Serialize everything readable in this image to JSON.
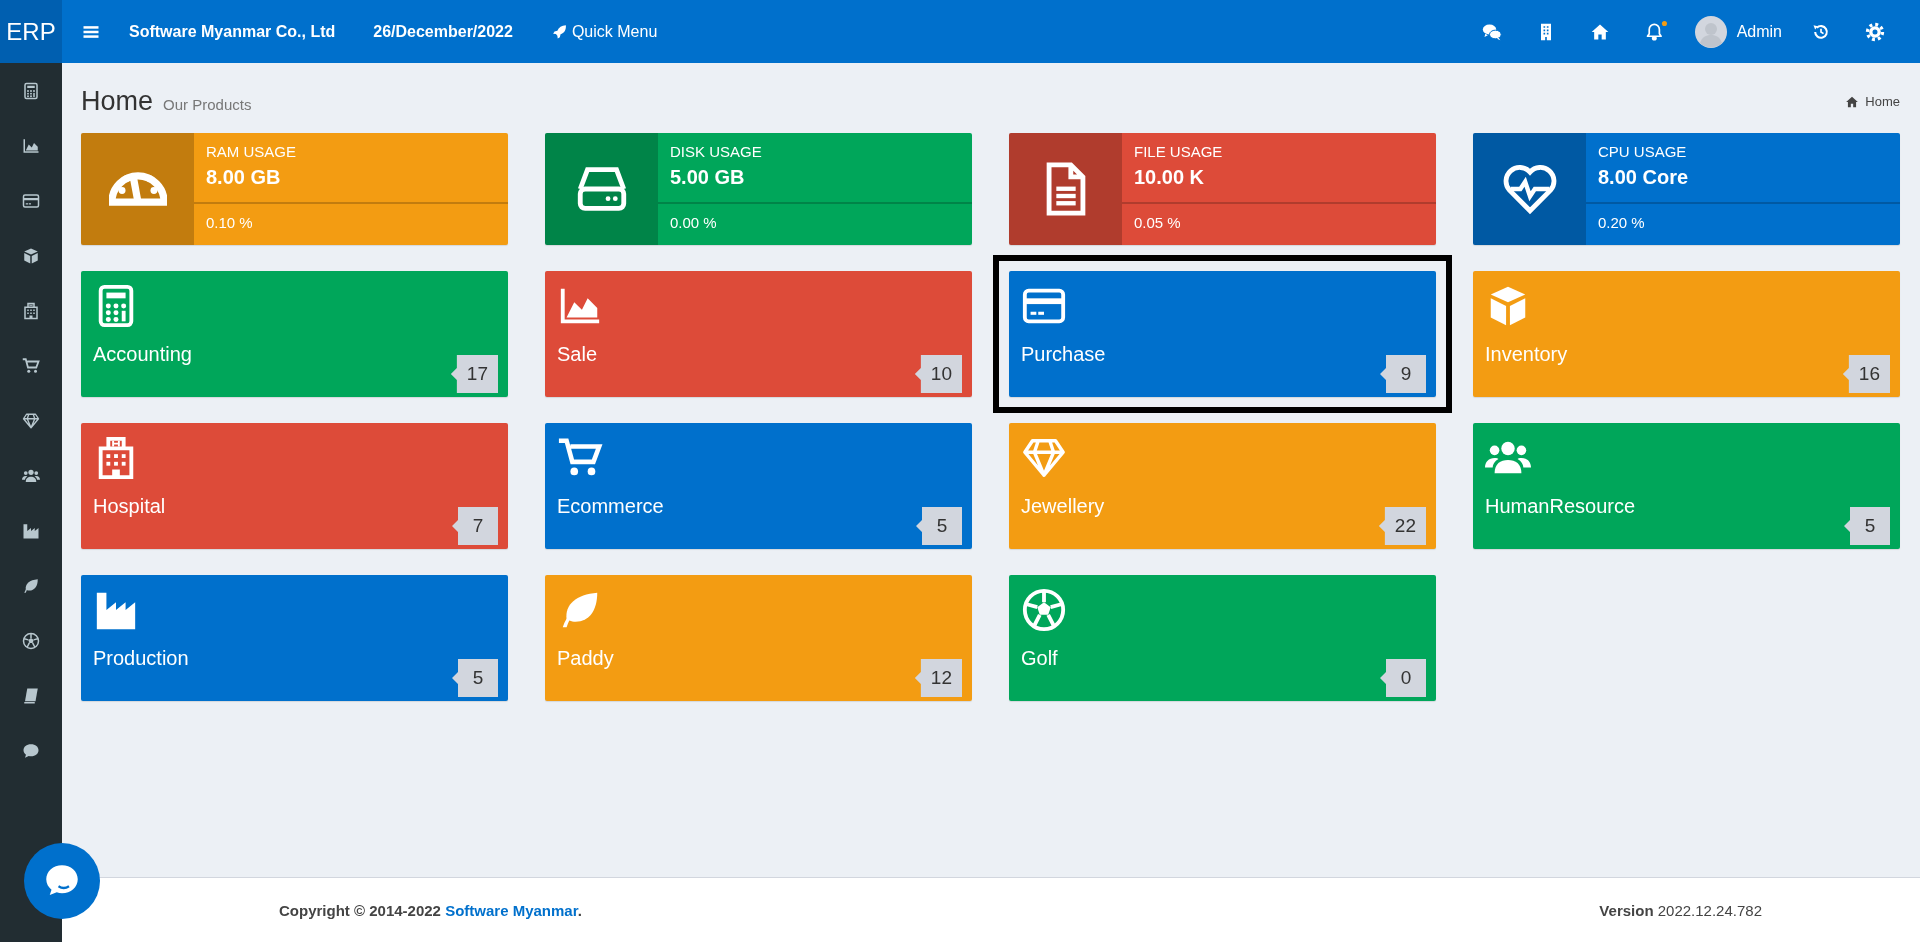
{
  "topbar": {
    "logo": "ERP",
    "company": "Software Myanmar Co., Ltd",
    "date": "26/December/2022",
    "quick_menu": "Quick Menu",
    "user": "Admin"
  },
  "header": {
    "title": "Home",
    "subtitle": "Our Products",
    "breadcrumb": "Home"
  },
  "stats": [
    {
      "label": "RAM USAGE",
      "value": "8.00 GB",
      "percent": "0.10 %",
      "color": "#f39c12"
    },
    {
      "label": "DISK USAGE",
      "value": "5.00 GB",
      "percent": "0.00 %",
      "color": "#00a65a"
    },
    {
      "label": "FILE USAGE",
      "value": "10.00 K",
      "percent": "0.05 %",
      "color": "#dd4b39"
    },
    {
      "label": "CPU USAGE",
      "value": "8.00 Core",
      "percent": "0.20 %",
      "color": "#0070cc"
    }
  ],
  "modules": [
    {
      "name": "Accounting",
      "count": "17",
      "color": "#00a65a",
      "selected": false
    },
    {
      "name": "Sale",
      "count": "10",
      "color": "#dd4b39",
      "selected": false
    },
    {
      "name": "Purchase",
      "count": "9",
      "color": "#0070cc",
      "selected": true
    },
    {
      "name": "Inventory",
      "count": "16",
      "color": "#f39c12",
      "selected": false
    },
    {
      "name": "Hospital",
      "count": "7",
      "color": "#dd4b39",
      "selected": false
    },
    {
      "name": "Ecommerce",
      "count": "5",
      "color": "#0070cc",
      "selected": false
    },
    {
      "name": "Jewellery",
      "count": "22",
      "color": "#f39c12",
      "selected": false
    },
    {
      "name": "HumanResource",
      "count": "5",
      "color": "#00a65a",
      "selected": false
    },
    {
      "name": "Production",
      "count": "5",
      "color": "#0070cc",
      "selected": false
    },
    {
      "name": "Paddy",
      "count": "12",
      "color": "#f39c12",
      "selected": false
    },
    {
      "name": "Golf",
      "count": "0",
      "color": "#00a65a",
      "selected": false
    }
  ],
  "footer": {
    "copyright": "Copyright © 2014-2022",
    "link": "Software Myanmar",
    "after": ".",
    "version": "**Version** 2022.12.24.782"
  }
}
